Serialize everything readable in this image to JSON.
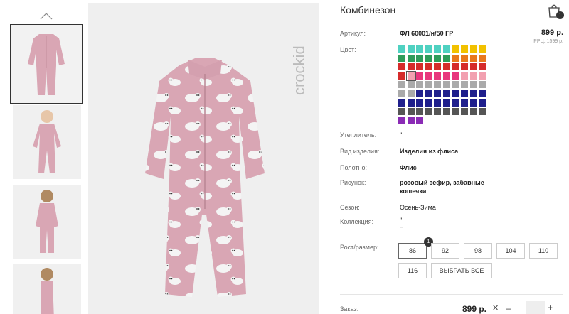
{
  "product": {
    "title": "Комбинезон",
    "cart_count": "1",
    "brand_logo_text": "crockid"
  },
  "details": {
    "article_label": "Артикул:",
    "article_value": "ФЛ 60001/н/50 ГР",
    "price": "899 р.",
    "rrp": "РРЦ: 1599 р.",
    "color_label": "Цвет:",
    "insulation_label": "Утеплитель:",
    "insulation_value": "\"",
    "type_label": "Вид изделия:",
    "type_value": "Изделия из флиса",
    "fabric_label": "Полотно:",
    "fabric_value": "Флис",
    "print_label": "Рисунок:",
    "print_value_line1": "розовый зефир, забавные",
    "print_value_line2": "кошечки",
    "season_label": "Сезон:",
    "season_value": "Осень-Зима",
    "collection_label": "Коллекция:",
    "collection_value_line1": "\"",
    "collection_value_line2": "–"
  },
  "sizes": {
    "label": "Рост/размер:",
    "options": [
      "86",
      "92",
      "98",
      "104",
      "110",
      "116"
    ],
    "selected_badge": "1",
    "select_all": "ВЫБРАТЬ ВСЕ"
  },
  "order": {
    "label": "Заказ:",
    "total": "899 р.",
    "clear_symbol": "✕",
    "minus": "–",
    "plus": "+"
  },
  "colors": {
    "rows": [
      [
        "#4fd1c1",
        "#4fd1c1",
        "#4fd1c1",
        "#4fd1c1",
        "#4fd1c1",
        "#4fd1c1",
        "#f2c100",
        "#f2c100",
        "#f2c100",
        "#f2c100"
      ],
      [
        "#2e9c5a",
        "#2e9c5a",
        "#2e9c5a",
        "#2e9c5a",
        "#2e9c5a",
        "#2e9c5a",
        "#e8781e",
        "#e8781e",
        "#e8781e",
        "#e8781e"
      ],
      [
        "#d52b2b",
        "#d52b2b",
        "#d52b2b",
        "#d52b2b",
        "#d52b2b",
        "#d52b2b",
        "#d52b2b",
        "#d52b2b",
        "#d52b2b",
        "#d52b2b"
      ],
      [
        "#d52b2b",
        "#f2a0b0",
        "#e8367e",
        "#e8367e",
        "#e8367e",
        "#e8367e",
        "#e8367e",
        "#f2a0b0",
        "#f2a0b0",
        "#f2a0b0"
      ],
      [
        "#aaaaaa",
        "#aaaaaa",
        "#aaaaaa",
        "#aaaaaa",
        "#aaaaaa",
        "#aaaaaa",
        "#aaaaaa",
        "#aaaaaa",
        "#aaaaaa",
        "#aaaaaa"
      ],
      [
        "#aaaaaa",
        "#aaaaaa",
        "#1f1f8c",
        "#1f1f8c",
        "#1f1f8c",
        "#1f1f8c",
        "#1f1f8c",
        "#1f1f8c",
        "#1f1f8c",
        "#1f1f8c"
      ],
      [
        "#1f1f8c",
        "#1f1f8c",
        "#1f1f8c",
        "#1f1f8c",
        "#1f1f8c",
        "#1f1f8c",
        "#1f1f8c",
        "#1f1f8c",
        "#1f1f8c",
        "#1f1f8c"
      ],
      [
        "#555555",
        "#555555",
        "#555555",
        "#555555",
        "#555555",
        "#555555",
        "#555555",
        "#555555",
        "#555555",
        "#555555"
      ],
      [
        "#8a2bb5",
        "#8a2bb5",
        "#8a2bb5"
      ]
    ],
    "selected": [
      3,
      1
    ]
  }
}
